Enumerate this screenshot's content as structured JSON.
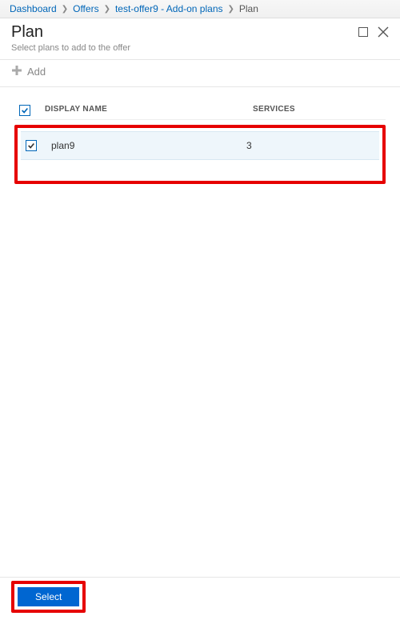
{
  "breadcrumb": {
    "items": [
      {
        "label": "Dashboard",
        "link": true
      },
      {
        "label": "Offers",
        "link": true
      },
      {
        "label": "test-offer9 - Add-on plans",
        "link": true
      },
      {
        "label": "Plan",
        "link": false
      }
    ]
  },
  "header": {
    "title": "Plan",
    "subtitle": "Select plans to add to the offer"
  },
  "toolbar": {
    "add_label": "Add"
  },
  "table": {
    "columns": {
      "display_name": "DISPLAY NAME",
      "services": "SERVICES"
    },
    "rows": [
      {
        "name": "plan9",
        "services": "3",
        "checked": true
      }
    ]
  },
  "footer": {
    "select_label": "Select"
  }
}
